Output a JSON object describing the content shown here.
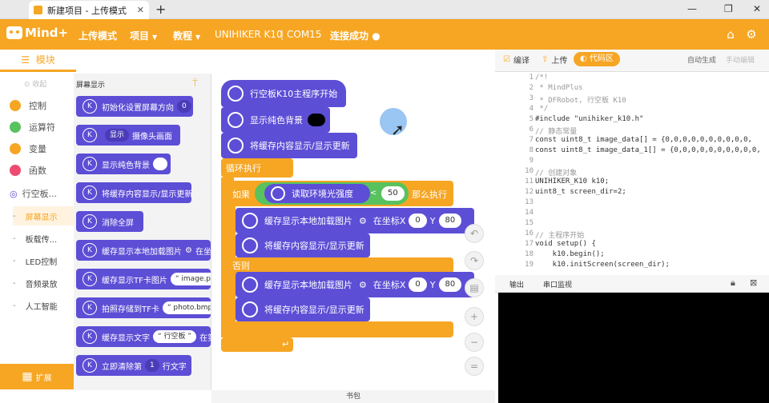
{
  "tab": {
    "title": "新建项目 - 上传模式",
    "close": "✕",
    "new": "+"
  },
  "window_controls": {
    "min": "—",
    "restore": "❐",
    "close": "✕"
  },
  "app": {
    "name": "Mind+"
  },
  "menu": {
    "mode": "上传模式",
    "project": "项目",
    "tutorial": "教程",
    "device": "UNIHIKER K10",
    "port": "COM15",
    "status": "连接成功"
  },
  "left": {
    "header": "模块",
    "items": [
      {
        "label": "控制",
        "color": "#f6a623"
      },
      {
        "label": "运算符",
        "color": "#58c25e"
      },
      {
        "label": "变量",
        "color": "#f6a623"
      },
      {
        "label": "函数",
        "color": "#ee4a72"
      }
    ],
    "board": "行空板...",
    "subs": [
      "屏幕显示",
      "板载传...",
      "LED控制",
      "音频录放",
      "人工智能"
    ],
    "ext": "扩展"
  },
  "flyout": {
    "title": "屏幕显示",
    "blocks": [
      {
        "text": "初始化设置屏幕方向",
        "opt": "0"
      },
      {
        "text": "显示",
        "opt": "摄像头画面"
      },
      {
        "text": "显示纯色背景"
      },
      {
        "text": "将缓存内容显示/显示更新"
      },
      {
        "text": "消除全屏"
      },
      {
        "text": "缓存显示本地加载图片",
        "extra": "在坐"
      },
      {
        "text": "缓存显示TF卡图片",
        "extra": "image.png"
      },
      {
        "text": "拍照存储到TF卡",
        "extra": "photo.bmp"
      },
      {
        "text": "缓存显示文字",
        "extra": "行空板",
        "tail": "在第"
      },
      {
        "text": "立即清除第",
        "opt": "1",
        "tail": "行文字"
      }
    ]
  },
  "workspace": {
    "hat": "行空板K10主程序开始",
    "bg": "显示纯色背景",
    "refresh": "将缓存内容显示/显示更新",
    "loop": "循环执行",
    "if": "如果",
    "sensor": "读取环境光强度",
    "op": "<",
    "threshold": "50",
    "then": "那么执行",
    "img": "缓存显示本地加载图片",
    "coord": "在坐标X",
    "x": "0",
    "y_label": "Y",
    "y": "80",
    "else": "否则",
    "arrow": "↵"
  },
  "code_toolbar": {
    "compile": "编译",
    "upload": "上传",
    "code": "代码区",
    "auto": "自动生成",
    "manual": "手动编辑"
  },
  "code": [
    {
      "n": "1",
      "t": "/*!"
    },
    {
      "n": "2",
      "t": " * MindPlus"
    },
    {
      "n": "3",
      "t": " * DFRobot, 行空板 K10"
    },
    {
      "n": "4",
      "t": " */"
    },
    {
      "n": "5",
      "t": "#include \"unihiker_k10.h\""
    },
    {
      "n": "6",
      "t": "// 静态常量"
    },
    {
      "n": "7",
      "t": "const uint8_t image_data[] = {0,0,0,0,0,0,0,0,0,0,"
    },
    {
      "n": "8",
      "t": "const uint8_t image_data_1[] = {0,0,0,0,0,0,0,0,0,0,"
    },
    {
      "n": "9",
      "t": ""
    },
    {
      "n": "10",
      "t": "// 创建对象"
    },
    {
      "n": "11",
      "t": "UNIHIKER_K10 k10;"
    },
    {
      "n": "12",
      "t": "uint8_t screen_dir=2;"
    },
    {
      "n": "13",
      "t": ""
    },
    {
      "n": "14",
      "t": ""
    },
    {
      "n": "15",
      "t": ""
    },
    {
      "n": "16",
      "t": "// 主程序开始"
    },
    {
      "n": "17",
      "t": "void setup() {"
    },
    {
      "n": "18",
      "t": "    k10.begin();"
    },
    {
      "n": "19",
      "t": "    k10.initScreen(screen_dir);"
    }
  ],
  "output": {
    "tab1": "输出",
    "tab2": "串口监视"
  },
  "status": {
    "label": "书包"
  }
}
